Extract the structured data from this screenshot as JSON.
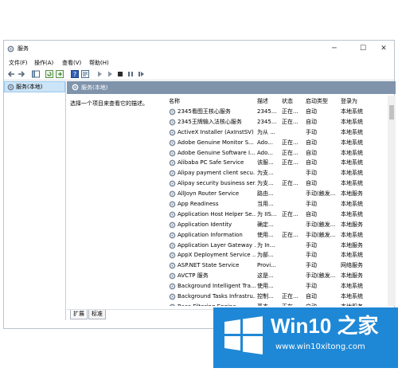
{
  "window": {
    "title": "服务",
    "min_glyph": "─",
    "max_glyph": "☐",
    "close_glyph": "✕"
  },
  "menu": {
    "file": "文件(F)",
    "action": "操作(A)",
    "view": "查看(V)",
    "help": "帮助(H)"
  },
  "toolbar": {
    "icons": [
      "back-icon",
      "forward-icon",
      "show-console-tree-icon",
      "refresh-icon",
      "export-list-icon",
      "help-icon",
      "properties-icon",
      "play-icon",
      "play-alt-icon",
      "stop-icon",
      "pause-icon",
      "restart-icon"
    ]
  },
  "sidebar": {
    "items": [
      {
        "label": "服务(本地)"
      }
    ]
  },
  "content": {
    "header": "服务(本地)",
    "description_hint": "选择一个项目来查看它的描述。",
    "columns": {
      "name": "名称",
      "desc": "描述",
      "status": "状态",
      "startup": "启动类型",
      "logon": "登录为"
    },
    "rows": [
      {
        "name": "2345看图王核心服务",
        "desc": "2345...",
        "status": "正在...",
        "startup": "自动",
        "logon": "本地系统"
      },
      {
        "name": "2345王牌输入法核心服务",
        "desc": "2345...",
        "status": "正在...",
        "startup": "自动",
        "logon": "本地系统"
      },
      {
        "name": "ActiveX Installer (AxInstSV)",
        "desc": "为从 ...",
        "status": "",
        "startup": "手动",
        "logon": "本地系统"
      },
      {
        "name": "Adobe Genuine Monitor S...",
        "desc": "Ado...",
        "status": "正在...",
        "startup": "自动",
        "logon": "本地系统"
      },
      {
        "name": "Adobe Genuine Software I...",
        "desc": "Ado...",
        "status": "正在...",
        "startup": "自动",
        "logon": "本地系统"
      },
      {
        "name": "Alibaba PC Safe Service",
        "desc": "该服...",
        "status": "正在...",
        "startup": "自动",
        "logon": "本地系统"
      },
      {
        "name": "Alipay payment client secu...",
        "desc": "为支...",
        "status": "",
        "startup": "手动",
        "logon": "本地系统"
      },
      {
        "name": "Alipay security business ser...",
        "desc": "为支...",
        "status": "正在...",
        "startup": "自动",
        "logon": "本地系统"
      },
      {
        "name": "AllJoyn Router Service",
        "desc": "路由...",
        "status": "",
        "startup": "手动(触发...",
        "logon": "本地服务"
      },
      {
        "name": "App Readiness",
        "desc": "当用...",
        "status": "",
        "startup": "手动",
        "logon": "本地系统"
      },
      {
        "name": "Application Host Helper Se...",
        "desc": "为 IIS...",
        "status": "正在...",
        "startup": "自动",
        "logon": "本地系统"
      },
      {
        "name": "Application Identity",
        "desc": "确定...",
        "status": "",
        "startup": "手动(触发...",
        "logon": "本地服务"
      },
      {
        "name": "Application Information",
        "desc": "使用...",
        "status": "正在...",
        "startup": "手动(触发...",
        "logon": "本地系统"
      },
      {
        "name": "Application Layer Gateway ...",
        "desc": "为 In...",
        "status": "",
        "startup": "手动",
        "logon": "本地服务"
      },
      {
        "name": "AppX Deployment Service ...",
        "desc": "为部...",
        "status": "",
        "startup": "手动",
        "logon": "本地系统"
      },
      {
        "name": "ASP.NET State Service",
        "desc": "Provi...",
        "status": "",
        "startup": "手动",
        "logon": "网络服务"
      },
      {
        "name": "AVCTP 服务",
        "desc": "这是...",
        "status": "",
        "startup": "手动(触发...",
        "logon": "本地服务"
      },
      {
        "name": "Background Intelligent Tra...",
        "desc": "使用...",
        "status": "",
        "startup": "手动",
        "logon": "本地系统"
      },
      {
        "name": "Background Tasks Infrastru...",
        "desc": "控制...",
        "status": "正在...",
        "startup": "自动",
        "logon": "本地系统"
      },
      {
        "name": "Base Filtering Engine",
        "desc": "基本...",
        "status": "正在...",
        "startup": "自动",
        "logon": "本地服务"
      }
    ]
  },
  "tabs": {
    "extended": "扩展",
    "standard": "标准"
  },
  "watermark": {
    "title": "Win10 之家",
    "url": "www.win10xitong.com"
  },
  "colors": {
    "header_bg": "#7f93ab",
    "selection": "#cce4f7",
    "brand_blue": "#1f88d6"
  }
}
